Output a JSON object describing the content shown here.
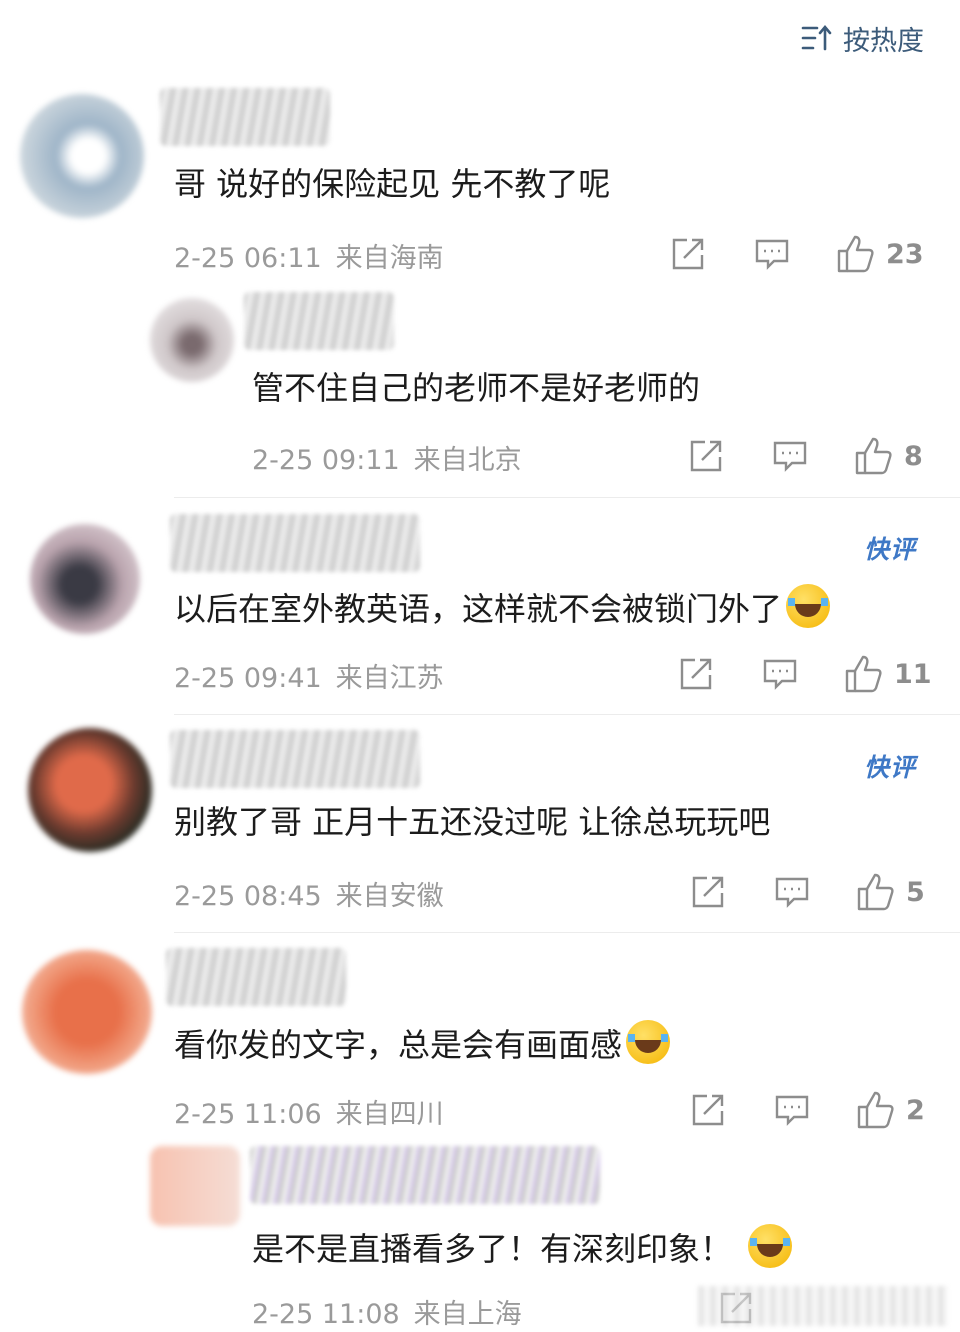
{
  "sort": {
    "label": "按热度",
    "icon": "sort-icon"
  },
  "badge_label": "快评",
  "comments": [
    {
      "text": "哥 说好的保险起见 先不教了呢",
      "time": "2-25 06:11",
      "location": "来自海南",
      "likes": "23"
    },
    {
      "text": "管不住自己的老师不是好老师的",
      "time": "2-25 09:11",
      "location": "来自北京",
      "likes": "8"
    },
    {
      "text": "以后在室外教英语，这样就不会被锁门外了",
      "time": "2-25 09:41",
      "location": "来自江苏",
      "likes": "11"
    },
    {
      "text": "别教了哥 正月十五还没过呢 让徐总玩玩吧",
      "time": "2-25 08:45",
      "location": "来自安徽",
      "likes": "5"
    },
    {
      "text": "看你发的文字，总是会有画面感",
      "time": "2-25 11:06",
      "location": "来自四川",
      "likes": "2"
    },
    {
      "text": "是不是直播看多了！有深刻印象！",
      "time": "2-25 11:08",
      "location": "来自上海",
      "likes": ""
    }
  ],
  "icons": {
    "share": "share-icon",
    "reply": "reply-icon",
    "like": "like-icon",
    "emoji": "laugh-cry-emoji-icon"
  },
  "colors": {
    "link_blue": "#3c5b7a",
    "badge_blue": "#3e78c6",
    "meta_gray": "#9a9a9a"
  }
}
